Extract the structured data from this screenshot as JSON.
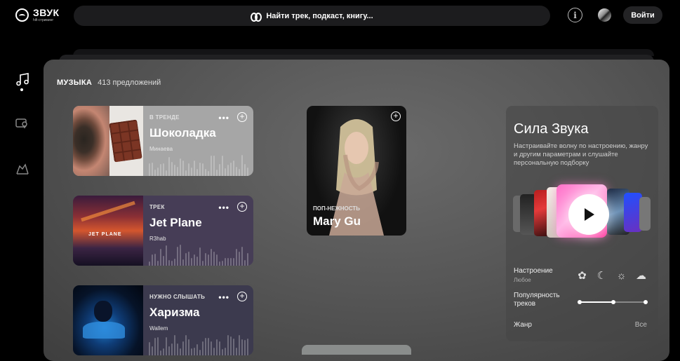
{
  "app": {
    "name": "ЗВУК",
    "tagline": "hifi-стриминг"
  },
  "search": {
    "placeholder": "Найти трек, подкаст, книгу..."
  },
  "header": {
    "info_label": "i",
    "login_label": "Войти"
  },
  "section": {
    "title": "МУЗЫКА",
    "count": "413 предложений"
  },
  "cards": [
    {
      "kicker": "В ТРЕНДЕ",
      "title": "Шоколадка",
      "artist": "Минаева",
      "more": "•••",
      "add": "+",
      "bg": "#a6a6a6"
    },
    {
      "kicker": "ТРЕК",
      "title": "Jet Plane",
      "artist": "R3hab",
      "more": "•••",
      "add": "+",
      "bg": "#463d56"
    },
    {
      "kicker": "НУЖНО СЛЫШАТЬ",
      "title": "Харизма",
      "artist": "Wallem",
      "more": "•••",
      "add": "+",
      "bg": "#3c3a4e"
    }
  ],
  "jet_art_text": "JET PLANE",
  "feature": {
    "kicker": "ПОП-НЕЖНОСТЬ",
    "title": "Mary Gu",
    "add": "+"
  },
  "wave": {
    "title": "Сила Звука",
    "description": "Настраивайте волну по настроению, жанру и другим параметрам и слушайте персональную подборку",
    "mood_label": "Настроение",
    "mood_value": "Любое",
    "popularity_label": "Популярность треков",
    "genre_label": "Жанр",
    "genre_value": "Все",
    "popularity_level": 0.5
  },
  "colors": {
    "background": "#000000",
    "panel": "#575757",
    "accent": "#ffffff"
  }
}
